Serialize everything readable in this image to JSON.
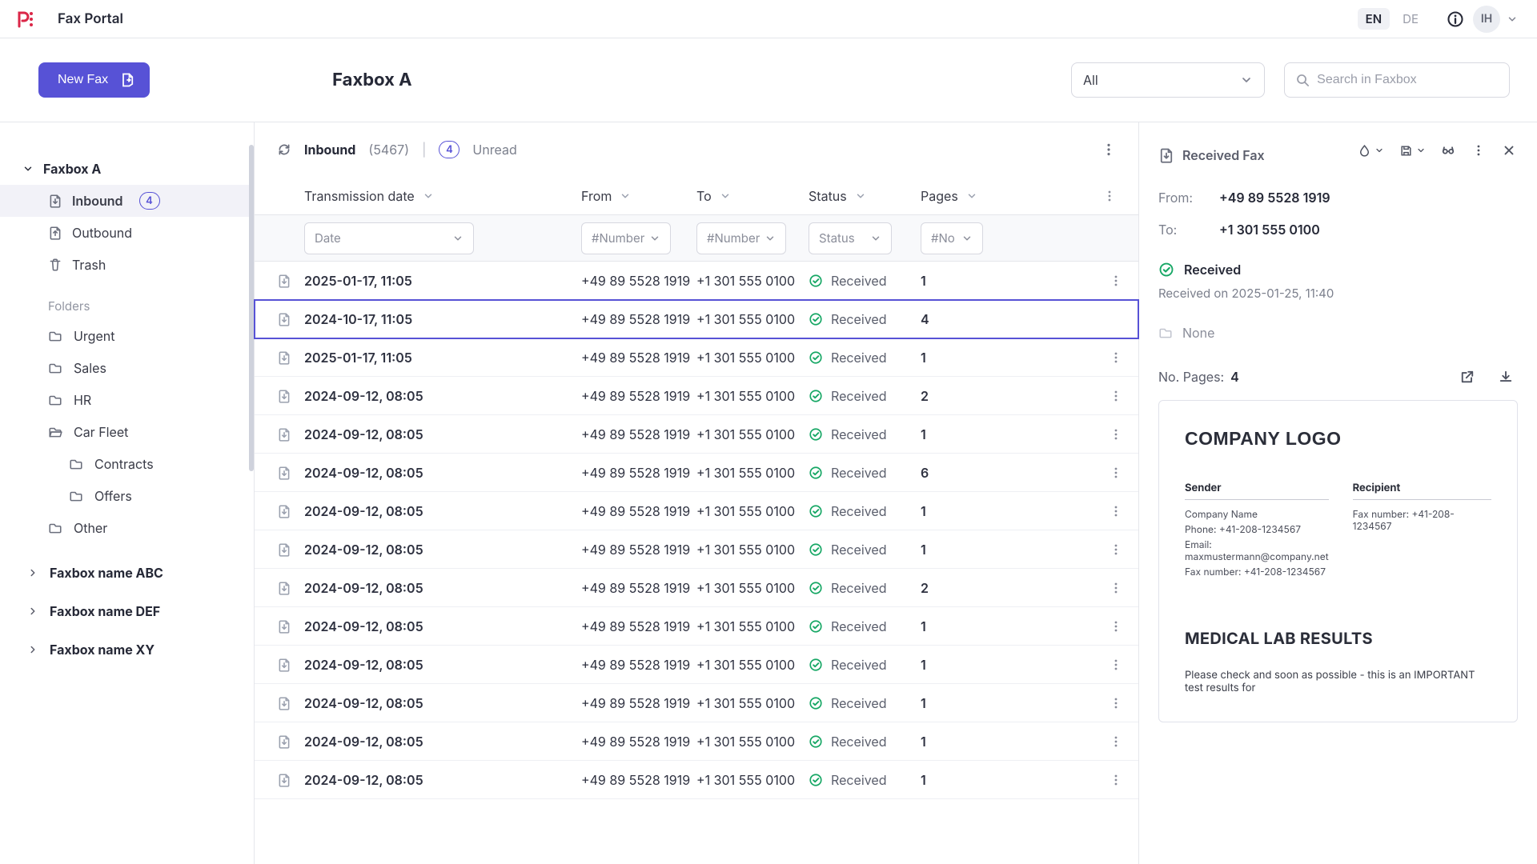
{
  "app_title": "Fax Portal",
  "languages": {
    "active": "EN",
    "inactive": "DE"
  },
  "avatar_initials": "IH",
  "new_fax_label": "New Fax",
  "page_title": "Faxbox A",
  "filter_select_value": "All",
  "search_placeholder": "Search in Faxbox",
  "sidebar": {
    "faxbox_active": "Faxbox A",
    "items": [
      {
        "label": "Inbound",
        "badge": "4"
      },
      {
        "label": "Outbound"
      },
      {
        "label": "Trash"
      }
    ],
    "folders_label": "Folders",
    "folders": [
      {
        "label": "Urgent"
      },
      {
        "label": "Sales"
      },
      {
        "label": "HR"
      },
      {
        "label": "Car Fleet",
        "children": [
          {
            "label": "Contracts"
          },
          {
            "label": "Offers"
          }
        ]
      },
      {
        "label": "Other"
      }
    ],
    "other_faxboxes": [
      "Faxbox name ABC",
      "Faxbox name DEF",
      "Faxbox name XY"
    ]
  },
  "listbar": {
    "title": "Inbound",
    "count": "(5467)",
    "unread_badge": "4",
    "unread_label": "Unread"
  },
  "columns": {
    "date": "Transmission date",
    "from": "From",
    "to": "To",
    "status": "Status",
    "pages": "Pages"
  },
  "filters": {
    "date": "Date",
    "number": "#Number",
    "status": "Status",
    "no": "#No"
  },
  "rows": [
    {
      "date": "2025-01-17, 11:05",
      "from": "+49 89 5528 1919",
      "to": "+1 301 555 0100",
      "status": "Received",
      "pages": "1"
    },
    {
      "date": "2024-10-17, 11:05",
      "from": "+49 89 5528 1919",
      "to": "+1 301 555 0100",
      "status": "Received",
      "pages": "4",
      "selected": true,
      "hide_menu": true
    },
    {
      "date": "2025-01-17, 11:05",
      "from": "+49 89 5528 1919",
      "to": "+1 301 555 0100",
      "status": "Received",
      "pages": "1"
    },
    {
      "date": "2024-09-12, 08:05",
      "from": "+49 89 5528 1919",
      "to": "+1 301 555 0100",
      "status": "Received",
      "pages": "2"
    },
    {
      "date": "2024-09-12, 08:05",
      "from": "+49 89 5528 1919",
      "to": "+1 301 555 0100",
      "status": "Received",
      "pages": "1"
    },
    {
      "date": "2024-09-12, 08:05",
      "from": "+49 89 5528 1919",
      "to": "+1 301 555 0100",
      "status": "Received",
      "pages": "6"
    },
    {
      "date": "2024-09-12, 08:05",
      "from": "+49 89 5528 1919",
      "to": "+1 301 555 0100",
      "status": "Received",
      "pages": "1"
    },
    {
      "date": "2024-09-12, 08:05",
      "from": "+49 89 5528 1919",
      "to": "+1 301 555 0100",
      "status": "Received",
      "pages": "1"
    },
    {
      "date": "2024-09-12, 08:05",
      "from": "+49 89 5528 1919",
      "to": "+1 301 555 0100",
      "status": "Received",
      "pages": "2"
    },
    {
      "date": "2024-09-12, 08:05",
      "from": "+49 89 5528 1919",
      "to": "+1 301 555 0100",
      "status": "Received",
      "pages": "1"
    },
    {
      "date": "2024-09-12, 08:05",
      "from": "+49 89 5528 1919",
      "to": "+1 301 555 0100",
      "status": "Received",
      "pages": "1"
    },
    {
      "date": "2024-09-12, 08:05",
      "from": "+49 89 5528 1919",
      "to": "+1 301 555 0100",
      "status": "Received",
      "pages": "1"
    },
    {
      "date": "2024-09-12, 08:05",
      "from": "+49 89 5528 1919",
      "to": "+1 301 555 0100",
      "status": "Received",
      "pages": "1"
    },
    {
      "date": "2024-09-12, 08:05",
      "from": "+49 89 5528 1919",
      "to": "+1 301 555 0100",
      "status": "Received",
      "pages": "1"
    }
  ],
  "detail": {
    "header_label": "Received Fax",
    "from_label": "From:",
    "from_value": "+49 89 5528 1919",
    "to_label": "To:",
    "to_value": "+1 301 555 0100",
    "status": "Received",
    "timestamp": "Received on 2025-01-25, 11:40",
    "none_label": "None",
    "pages_label": "No. Pages:",
    "pages_value": "4",
    "preview": {
      "logo": "COMPANY LOGO",
      "sender_label": "Sender",
      "recipient_label": "Recipient",
      "sender_lines": [
        "Company Name",
        "Phone: +41-208-1234567",
        "Email: maxmustermann@company.net",
        "Fax number: +41-208-1234567"
      ],
      "recipient_lines": [
        "Fax number: +41-208-1234567"
      ],
      "title": "MEDICAL LAB RESULTS",
      "body": "Please check and  soon as possible - this is an IMPORTANT test results for"
    }
  }
}
